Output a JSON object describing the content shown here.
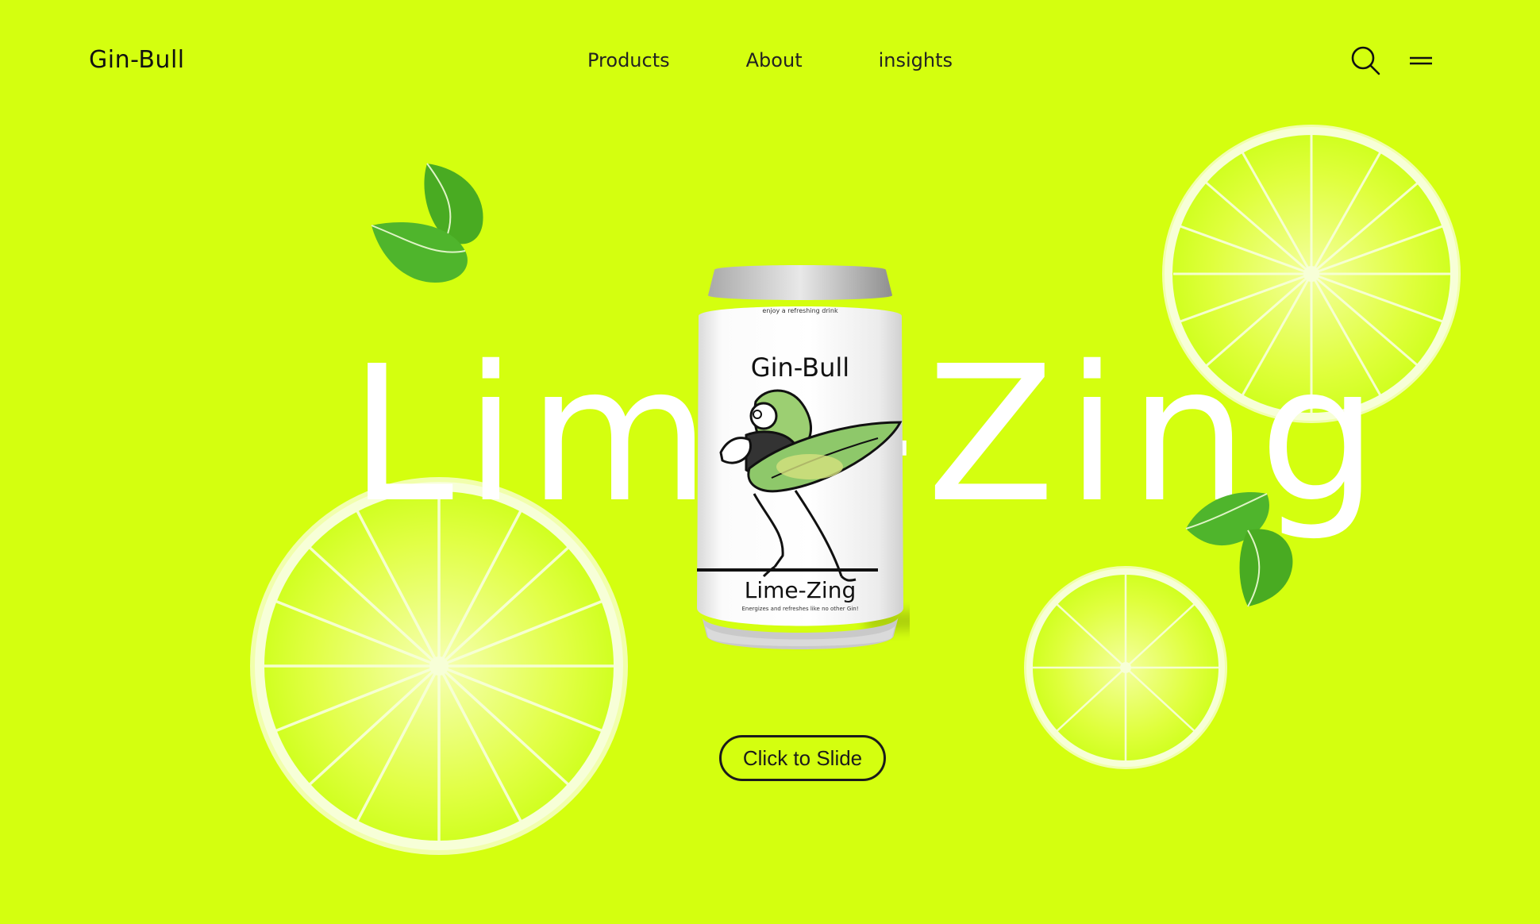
{
  "header": {
    "logo": "Gin-Bull",
    "nav": [
      "Products",
      "About",
      "insights"
    ],
    "icons": [
      "search-icon",
      "menu-icon"
    ]
  },
  "hero": {
    "word": "Lime-Zing"
  },
  "can": {
    "tagline": "enjoy a refreshing drink",
    "brand": "Gin-Bull",
    "flavor": "Lime-Zing",
    "subline": "Energizes and refreshes like no other Gin!"
  },
  "cta": {
    "label": "Click to Slide"
  },
  "colors": {
    "background": "#d4ff0f",
    "text": "#111111",
    "white": "#ffffff",
    "leaf": "#4fb52c"
  }
}
